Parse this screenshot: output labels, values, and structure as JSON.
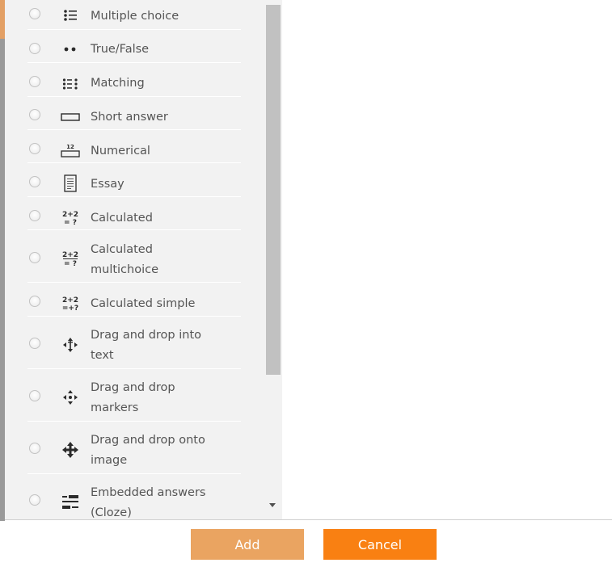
{
  "question_types": [
    {
      "label": "Multiple choice",
      "icon": "multiple-choice-icon"
    },
    {
      "label": "True/False",
      "icon": "true-false-icon"
    },
    {
      "label": "Matching",
      "icon": "matching-icon"
    },
    {
      "label": "Short answer",
      "icon": "short-answer-icon"
    },
    {
      "label": "Numerical",
      "icon": "numerical-icon"
    },
    {
      "label": "Essay",
      "icon": "essay-icon"
    },
    {
      "label": "Calculated",
      "icon": "calculated-icon"
    },
    {
      "label": "Calculated\nmultichoice",
      "icon": "calculated-multichoice-icon"
    },
    {
      "label": "Calculated simple",
      "icon": "calculated-simple-icon"
    },
    {
      "label": "Drag and drop into\ntext",
      "icon": "drag-drop-text-icon"
    },
    {
      "label": "Drag and drop\nmarkers",
      "icon": "drag-drop-markers-icon"
    },
    {
      "label": "Drag and drop onto\nimage",
      "icon": "drag-drop-image-icon"
    },
    {
      "label": "Embedded answers\n(Cloze)",
      "icon": "embedded-answers-icon"
    }
  ],
  "icon_text": {
    "numerical": "12",
    "calculated": "2+2\n= ?"
  },
  "buttons": {
    "add": "Add",
    "cancel": "Cancel"
  },
  "colors": {
    "add_button": "#eaa461",
    "cancel_button": "#f98012",
    "list_background": "#f2f2f2"
  }
}
